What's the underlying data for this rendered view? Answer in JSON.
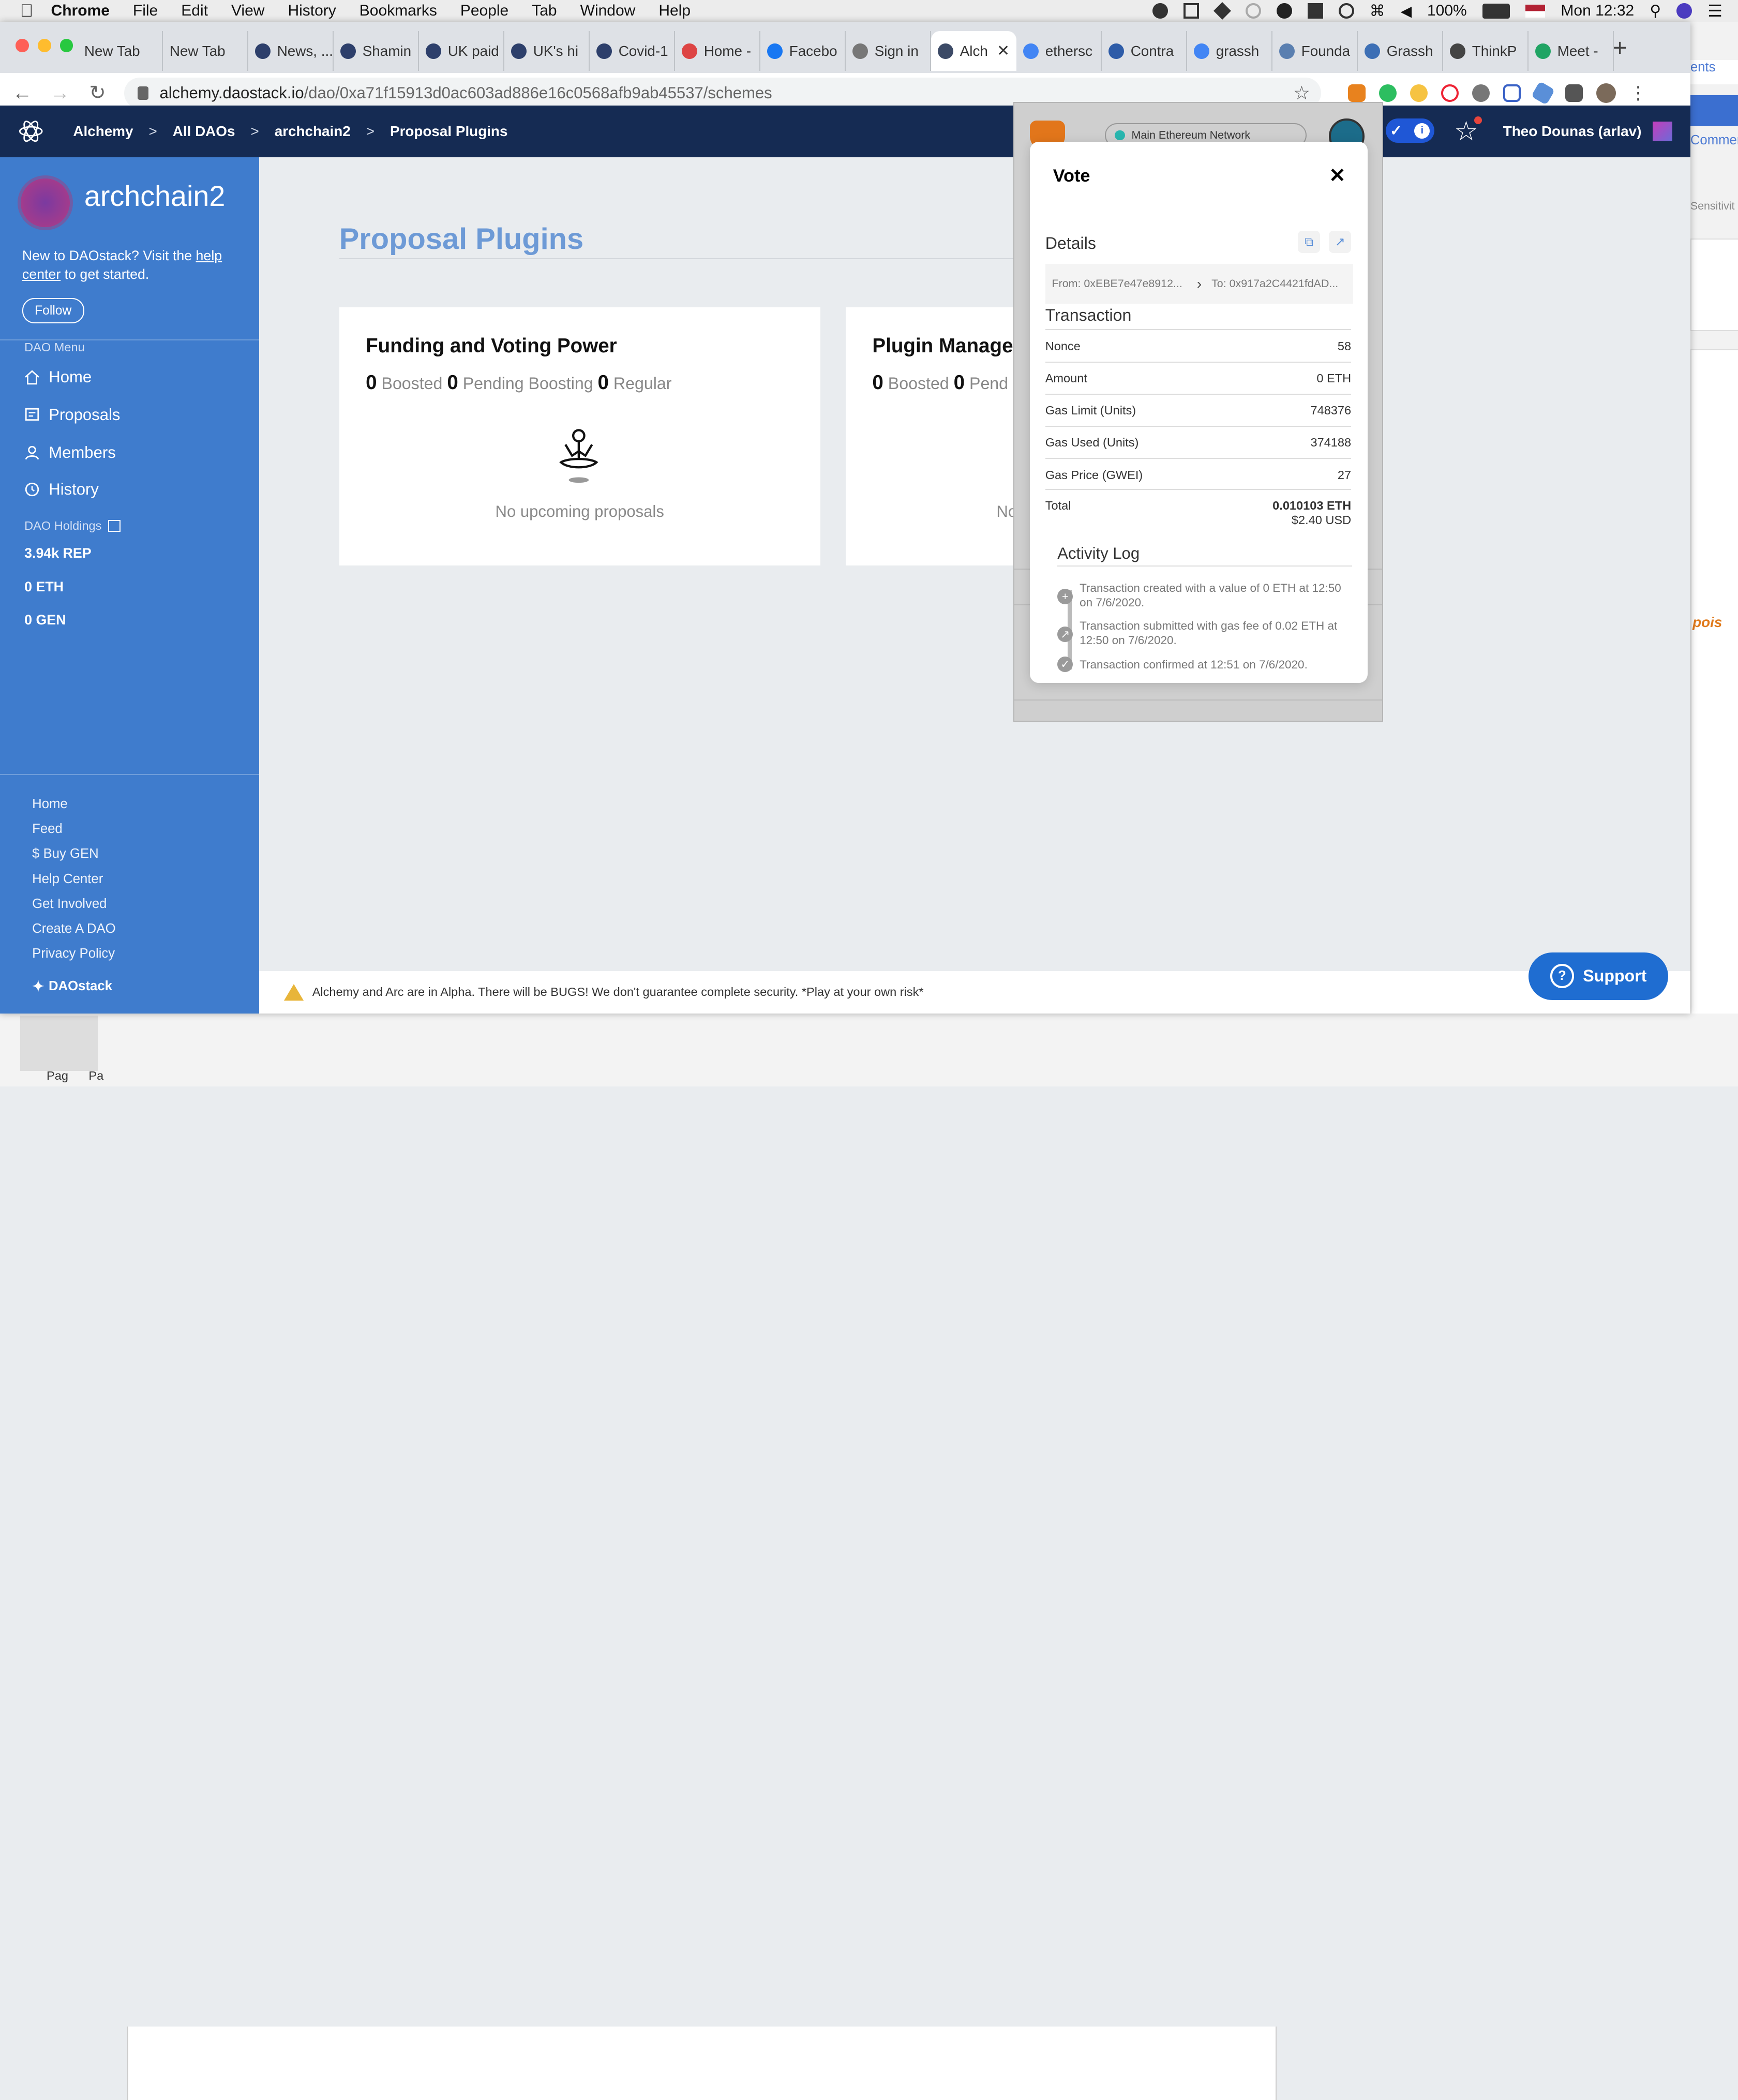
{
  "menubar": {
    "apple": "",
    "app": "Chrome",
    "items": [
      "File",
      "Edit",
      "View",
      "History",
      "Bookmarks",
      "People",
      "Tab",
      "Window",
      "Help"
    ],
    "battery": "100%",
    "clock": "Mon 12:32"
  },
  "browser": {
    "tabs": [
      {
        "label": "New Tab"
      },
      {
        "label": "New Tab"
      },
      {
        "label": "News, ..."
      },
      {
        "label": "Shamin"
      },
      {
        "label": "UK paid"
      },
      {
        "label": "UK's hi"
      },
      {
        "label": "Covid-1"
      },
      {
        "label": "Home -"
      },
      {
        "label": "Facebo"
      },
      {
        "label": "Sign in"
      },
      {
        "label": "Alch"
      },
      {
        "label": "ethersc"
      },
      {
        "label": "Contra"
      },
      {
        "label": "grassh"
      },
      {
        "label": "Founda"
      },
      {
        "label": "Grassh"
      },
      {
        "label": "ThinkP"
      },
      {
        "label": "Meet -"
      }
    ],
    "url_host": "alchemy.daostack.io",
    "url_path": "/dao/0xa71f15913d0ac603ad886e16c0568afb9ab45537/schemes"
  },
  "appbar": {
    "breadcrumbs": [
      "Alchemy",
      "All DAOs",
      "archchain2",
      "Proposal Plugins"
    ],
    "user": "Theo Dounas (arlav)"
  },
  "sidebar": {
    "dao_name": "archchain2",
    "help_prefix": "New to DAOstack? Visit the ",
    "help_link": "help center",
    "help_suffix": " to get started.",
    "follow": "Follow",
    "menu_heading": "DAO Menu",
    "menu": [
      "Home",
      "Proposals",
      "Members",
      "History"
    ],
    "holdings_heading": "DAO Holdings",
    "holdings": [
      "3.94k REP",
      "0 ETH",
      "0 GEN"
    ],
    "footer": [
      "Home",
      "Feed",
      "$ Buy GEN",
      "Help Center",
      "Get Involved",
      "Create A DAO",
      "Privacy Policy"
    ],
    "brand": "DAOstack"
  },
  "main": {
    "title": "Proposal Plugins",
    "cards": [
      {
        "title": "Funding and Voting Power",
        "boosted": "0",
        "boosted_label": "Boosted",
        "pending": "0",
        "pending_label": "Pending Boosting",
        "regular": "0",
        "regular_label": "Regular",
        "empty": "No upcoming proposals"
      },
      {
        "title": "Plugin Manager",
        "boosted": "0",
        "boosted_label": "Boosted",
        "pending": "0",
        "pending_label": "Pend",
        "empty": "No"
      }
    ],
    "alpha_notice": "Alchemy and Arc are in Alpha. There will be BUGS! We don't guarantee complete security. *Play at your own risk*",
    "support": "Support"
  },
  "metamask": {
    "network": "Main Ethereum Network",
    "modal_title": "Vote",
    "details": "Details",
    "from": "From: 0xEBE7e47e8912...",
    "to": "To: 0x917a2C4421fdAD...",
    "transaction": "Transaction",
    "rows": [
      {
        "label": "Nonce",
        "value": "58"
      },
      {
        "label": "Amount",
        "value": "0 ETH"
      },
      {
        "label": "Gas Limit (Units)",
        "value": "748376"
      },
      {
        "label": "Gas Used (Units)",
        "value": "374188"
      },
      {
        "label": "Gas Price (GWEI)",
        "value": "27"
      }
    ],
    "total_label": "Total",
    "total_eth": "0.010103 ETH",
    "total_usd": "$2.40 USD",
    "activity_title": "Activity Log",
    "activity": [
      "Transaction created with a value of 0 ETH at 12:50 on 7/6/2020.",
      "Transaction submitted with gas fee of 0.02 ETH at 12:50 on 7/6/2020.",
      "Transaction confirmed at 12:51 on 7/6/2020."
    ]
  },
  "background_app": {
    "fragments": [
      "ents",
      "Commen",
      "Sensitivit",
      "pois",
      "Pag",
      "Pa"
    ]
  }
}
